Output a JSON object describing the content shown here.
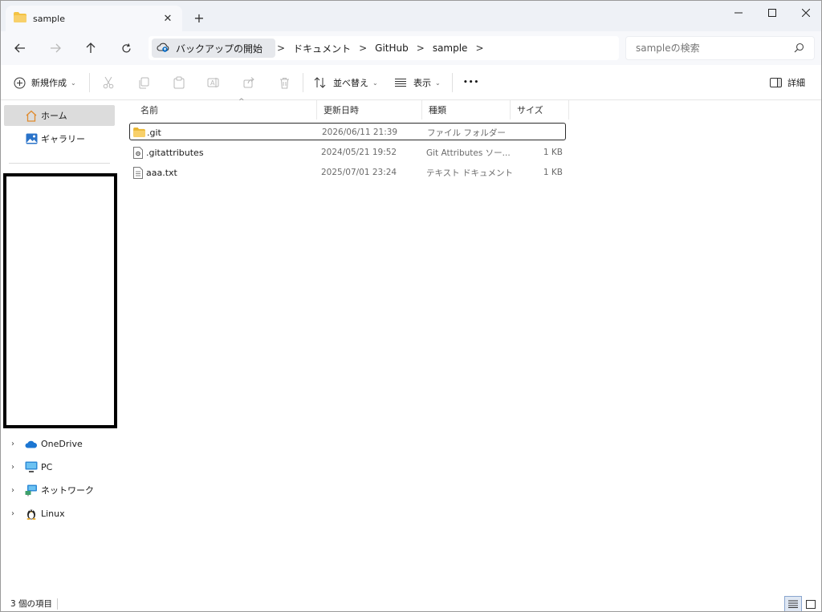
{
  "window": {
    "tab_title": "sample",
    "new_tab_label": "+",
    "minimize_label": "─",
    "maximize_label": "☐",
    "close_label": "✕"
  },
  "nav": {
    "back_icon": "arrow-left-icon",
    "forward_icon": "arrow-right-icon",
    "up_icon": "arrow-up-icon",
    "refresh_icon": "refresh-icon"
  },
  "address": {
    "breadcrumbs": [
      "バックアップの開始",
      "ドキュメント",
      "GitHub",
      "sample"
    ],
    "separator": ">"
  },
  "search": {
    "placeholder": "sampleの検索"
  },
  "commands": {
    "new_label": "新規作成",
    "sort_label": "並べ替え",
    "view_label": "表示",
    "more_label": "•••",
    "details_label": "詳細"
  },
  "sidebar": {
    "home": "ホーム",
    "gallery": "ギャラリー",
    "tree": [
      "OneDrive",
      "PC",
      "ネットワーク",
      "Linux"
    ]
  },
  "columns": {
    "name": "名前",
    "modified": "更新日時",
    "type": "種類",
    "size": "サイズ"
  },
  "files": [
    {
      "name": ".git",
      "modified": "2026/06/11 21:39",
      "type": "ファイル フォルダー",
      "size": "",
      "icon": "folder-icon"
    },
    {
      "name": ".gitattributes",
      "modified": "2024/05/21 19:52",
      "type": "Git Attributes ソー...",
      "size": "1 KB",
      "icon": "settings-file-icon"
    },
    {
      "name": "aaa.txt",
      "modified": "2025/07/01 23:24",
      "type": "テキスト ドキュメント",
      "size": "1 KB",
      "icon": "text-file-icon"
    }
  ],
  "status": {
    "item_count": "3 個の項目"
  },
  "colors": {
    "accent": "#0067c0",
    "folder": "#f3c344",
    "selected_nav": "#dcdcdc",
    "titlebar": "#eef1f6"
  }
}
